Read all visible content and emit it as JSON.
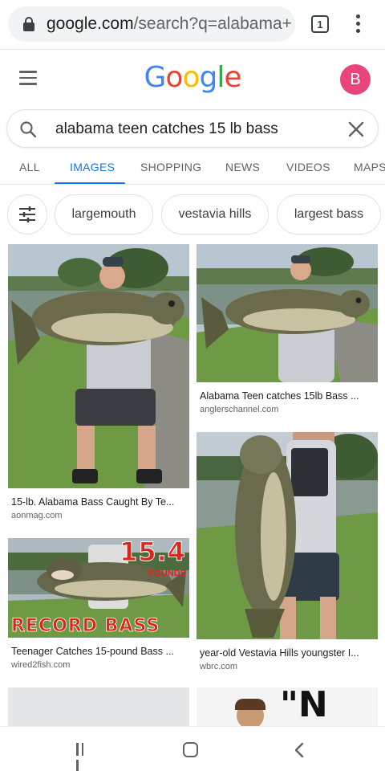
{
  "browser": {
    "url_host": "google.com",
    "url_path": "/search?q=alabama+",
    "tab_count": "1"
  },
  "header": {
    "logo_letters": [
      "G",
      "o",
      "o",
      "g",
      "l",
      "e"
    ],
    "logo_colors": [
      "#4285F4",
      "#EA4335",
      "#FBBC05",
      "#4285F4",
      "#34A853",
      "#EA4335"
    ],
    "avatar_letter": "B",
    "avatar_color": "#e8457d"
  },
  "search": {
    "query": "alabama teen catches 15 lb bass"
  },
  "tabs": [
    "ALL",
    "IMAGES",
    "SHOPPING",
    "NEWS",
    "VIDEOS",
    "MAPS"
  ],
  "active_tab": "IMAGES",
  "chips": [
    "largemouth",
    "vestavia hills",
    "largest bass"
  ],
  "results": [
    {
      "title": "15-lb. Alabama Bass Caught By Te...",
      "source": "aonmag.com"
    },
    {
      "title": "Alabama Teen catches 15lb Bass ...",
      "source": "anglerschannel.com"
    },
    {
      "title": "Teenager Catches 15-pound Bass ...",
      "source": "wired2fish.com",
      "overlay_top": "15.4",
      "overlay_sub": "POUNDS",
      "overlay_bottom": "RECORD BASS"
    },
    {
      "title": "year-old Vestavia Hills youngster I...",
      "source": "wbrc.com"
    }
  ],
  "partial_results": [
    {
      "overlay_text": "\"N"
    }
  ],
  "colors": {
    "accent": "#1a73e8",
    "record_red": "#e0241b"
  }
}
